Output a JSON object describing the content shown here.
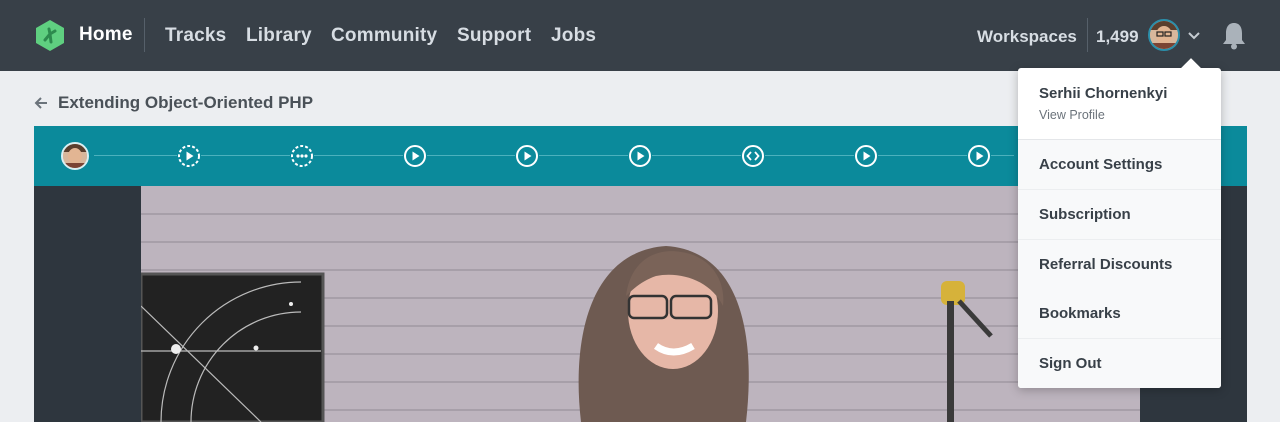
{
  "nav": {
    "home": "Home",
    "links": [
      "Tracks",
      "Library",
      "Community",
      "Support",
      "Jobs"
    ],
    "workspaces": "Workspaces",
    "points": "1,499",
    "icons": {
      "logo": "treehouse-logo-icon",
      "chevron": "chevron-down-icon",
      "bell": "bell-icon"
    }
  },
  "breadcrumb": {
    "title": "Extending Object-Oriented PHP",
    "icon": "arrow-left-icon"
  },
  "stages": {
    "steps": [
      "avatar",
      "video-current",
      "quiz",
      "video",
      "video",
      "video",
      "code-challenge",
      "video",
      "video"
    ]
  },
  "dropdown": {
    "name": "Serhii Chornenkyi",
    "view_profile": "View Profile",
    "items": [
      "Account Settings",
      "Subscription",
      "Referral Discounts",
      "Bookmarks",
      "Sign Out"
    ]
  },
  "colors": {
    "nav_bg": "#384048",
    "accent": "#0b8a9b",
    "logo_green": "#5fcf80"
  }
}
